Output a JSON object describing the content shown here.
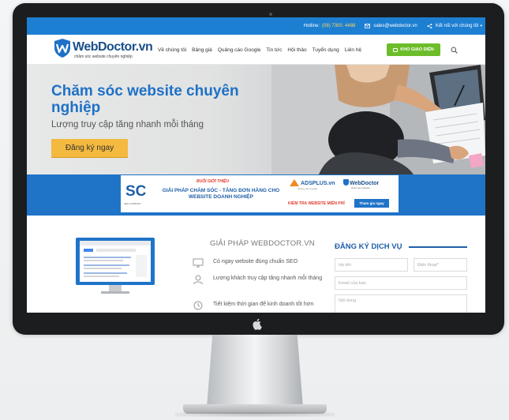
{
  "topbar": {
    "hotline_label": "Hotline:",
    "hotline_value": "(08) 7300. 4488",
    "email": "sales@webdoctor.vn",
    "connect": "Kết nối với chúng tôi"
  },
  "brand": {
    "name": "WebDoctor.vn",
    "tagline": "chăm sóc website chuyên nghiệp"
  },
  "nav": {
    "items": [
      "Về chúng tôi",
      "Bảng giá",
      "Quảng cáo Google",
      "Tin tức",
      "Hội thảo",
      "Tuyển dụng",
      "Liên hệ"
    ],
    "cta": "KHO GIAO DIỆN"
  },
  "hero": {
    "title": "Chăm sóc website chuyên nghiệp",
    "subtitle": "Lượng truy cập tăng nhanh mỗi tháng",
    "cta": "Đăng ký ngay"
  },
  "banner": {
    "sc_caption": "SEO COMPANY",
    "intro": "BUỔI GIỚI THIỆU",
    "headline": "GIẢI PHÁP CHĂM SÓC - TĂNG ĐƠN HÀNG CHO WEBSITE DOANH NGHIỆP",
    "partner": "ADSPLUS.vn",
    "partner_sub": "Quảng cáo Google",
    "brand": "WebDoctor",
    "brand_sub": "chăm sóc website",
    "free_check": "KIỂM TRA WEBSITE MIỄN PHÍ",
    "join": "Tham gia ngay"
  },
  "solutions": {
    "title": "GIẢI PHÁP WEBDOCTOR.VN",
    "features": [
      "Có ngay website đúng chuẩn SEO",
      "Lượng khách truy cập tăng nhanh mỗi tháng",
      "Tiết kiệm thời gian để kinh doanh tốt hơn"
    ]
  },
  "register": {
    "title": "ĐĂNG KÝ DỊCH VỤ",
    "name_placeholder": "Họ tên",
    "phone_placeholder": "Điện thoại*",
    "email_placeholder": "Email của bạn",
    "content_placeholder": "Nội dung"
  },
  "colors": {
    "primary_blue": "#1d7fd2",
    "cta_yellow": "#f4b93f",
    "cta_green": "#6dbd2a",
    "accent_red": "#e23b2d"
  }
}
